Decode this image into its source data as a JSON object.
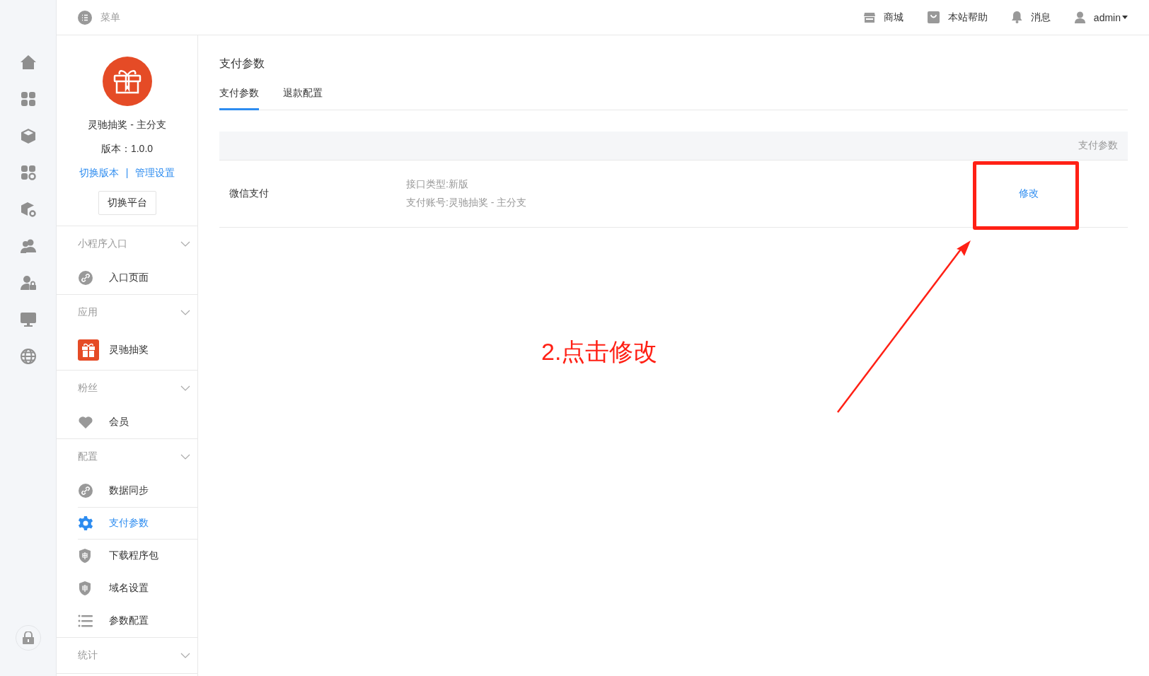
{
  "topbar": {
    "menu_label": "菜单",
    "links": [
      {
        "kind": "shop",
        "label": "商城"
      },
      {
        "kind": "help",
        "label": "本站帮助"
      },
      {
        "kind": "bell",
        "label": "消息"
      },
      {
        "kind": "user",
        "label": "admin",
        "dropdown": true
      }
    ]
  },
  "app_card": {
    "name": "灵驰抽奖 - 主分支",
    "version": "版本：1.0.0",
    "links": [
      "切换版本",
      "管理设置"
    ],
    "separator": "|",
    "button": "切换平台"
  },
  "sidebar": {
    "groups": [
      {
        "title": "小程序入口",
        "items": [
          {
            "kind": "link",
            "label": "入口页面",
            "selected": false
          }
        ]
      },
      {
        "title": "应用",
        "items": [
          {
            "kind": "gift",
            "label": "灵驰抽奖",
            "selected": false
          }
        ]
      },
      {
        "title": "粉丝",
        "items": [
          {
            "kind": "heart",
            "label": "会员",
            "selected": false
          }
        ]
      },
      {
        "title": "配置",
        "items": [
          {
            "kind": "link",
            "label": "数据同步",
            "selected": false
          },
          {
            "kind": "gear",
            "label": "支付参数",
            "selected": true
          },
          {
            "kind": "shield",
            "label": "下载程序包",
            "selected": false
          },
          {
            "kind": "shield",
            "label": "域名设置",
            "selected": false
          },
          {
            "kind": "list",
            "label": "参数配置",
            "selected": false
          }
        ]
      },
      {
        "title": "统计"
      }
    ]
  },
  "page": {
    "title": "支付参数",
    "tabs": [
      {
        "label": "支付参数",
        "selected": true
      },
      {
        "label": "退款配置",
        "selected": false
      }
    ],
    "table": {
      "header": "支付参数",
      "rows": [
        {
          "name": "微信支付",
          "details": [
            "接口类型:新版",
            "支付账号:灵驰抽奖 - 主分支"
          ],
          "action": "修改"
        }
      ]
    }
  },
  "annotation": {
    "text": "2.点击修改"
  }
}
